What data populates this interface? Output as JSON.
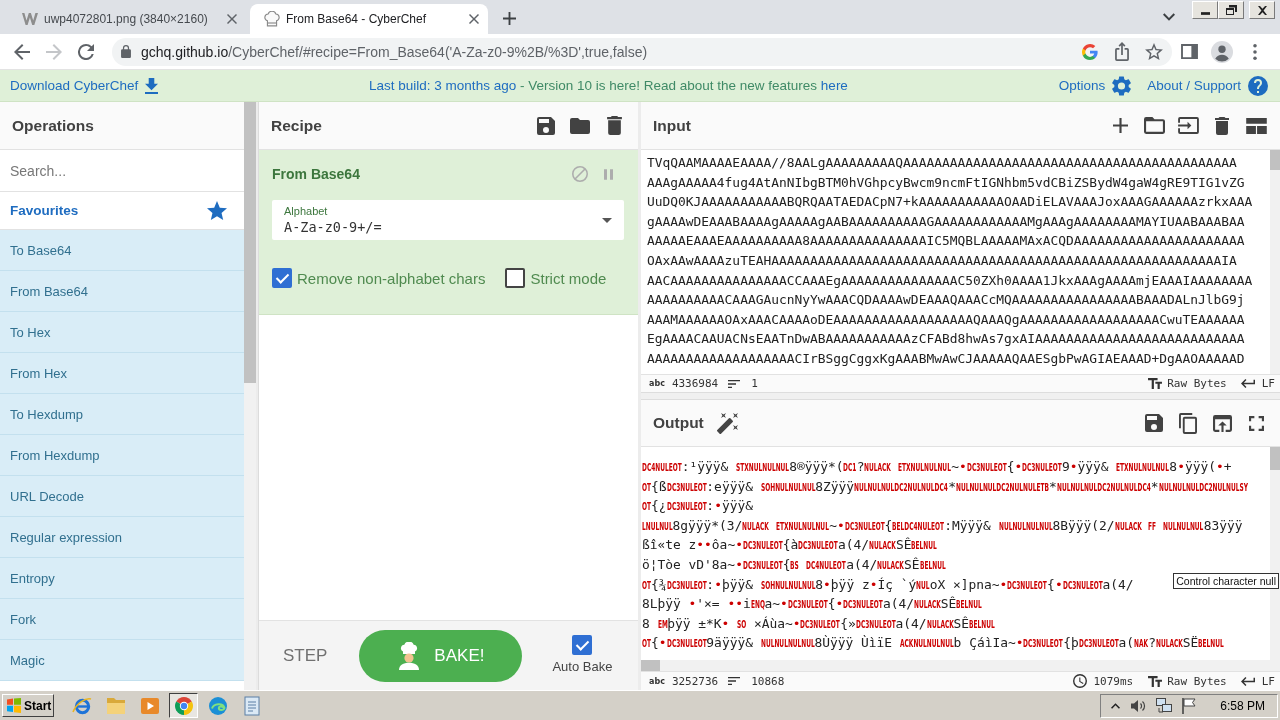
{
  "browser": {
    "tabs": [
      {
        "kind": "w-logo",
        "title": "uwp4072801.png (3840×2160)",
        "selected": false
      },
      {
        "kind": "chef-hat",
        "title": "From Base64 - CyberChef",
        "selected": true
      }
    ],
    "forward": {
      "disabled": true
    },
    "url": {
      "host": "gchq.github.io",
      "path": "/CyberChef/#recipe=From_Base64('A-Za-z0-9%2B/%3D',true,false)"
    }
  },
  "banner": {
    "download": "Download CyberChef",
    "notice": [
      {
        "kind": "link",
        "text": "Last build: 3 months ago"
      },
      {
        "kind": "text",
        "text": " - Version 10 is here! Read about the new features "
      },
      {
        "kind": "link",
        "text": "here"
      }
    ],
    "options": "Options",
    "about": "About / Support"
  },
  "operations": {
    "title": "Operations",
    "search": {
      "placeholder": "Search..."
    },
    "category": "Favourites",
    "items": [
      "To Base64",
      "From Base64",
      "To Hex",
      "From Hex",
      "To Hexdump",
      "From Hexdump",
      "URL Decode",
      "Regular expression",
      "Entropy",
      "Fork",
      "Magic"
    ]
  },
  "recipe": {
    "title": "Recipe",
    "operation": {
      "name": "From Base64",
      "field": {
        "label": "Alphabet",
        "value": "A-Za-z0-9+/="
      },
      "options": [
        {
          "label": "Remove non-alphabet chars",
          "checked": true
        },
        {
          "label": "Strict mode",
          "checked": false
        }
      ]
    },
    "step": "STEP",
    "bake": "BAKE!",
    "auto_bake": {
      "label": "Auto Bake",
      "checked": true
    }
  },
  "input": {
    "title": "Input",
    "lines": [
      "TVqQAAMAAAAEAAAA//8AALgAAAAAAAAAQAAAAAAAAAAAAAAAAAAAAAAAAAAAAAAAAAAAAAAAAAAA",
      "AAAgAAAAA4fug4AtAnNIbgBTM0hVGhpcyBwcm9ncmFtIGNhbm5vdCBiZSBydW4gaW4gRE9TIG1vZG",
      "UuDQ0KJAAAAAAAAAAABQRQAATAEDACpN7+kAAAAAAAAAAAOAADiELAVAAAJoxAAAGAAAAAAzrkxAAA",
      "gAAAAwDEAAABAAAAgAAAAAgAABAAAAAAAAAAGAAAAAAAAAAAAMgAAAgAAAAAAAAMAYIUAABAAABAA",
      "AAAAAEAAAEAAAAAAAAAA8AAAAAAAAAAAAAAAIC5MQBLAAAAAMAxACQDAAAAAAAAAAAAAAAAAAAAAA",
      "OAxAAwAAAAzuTEAHAAAAAAAAAAAAAAAAAAAAAAAAAAAAAAAAAAAAAAAAAAAAAAAAAAAAAAAAAAIA",
      "AACAAAAAAAAAAAAAAACCAAAEgAAAAAAAAAAAAAAAC50ZXh0AAAA1JkxAAAgAAAAmjEAAAIAAAAAAAA",
      "AAAAAAAAAACAAAGAucnNyYwAAACQDAAAAwDEAAAQAAACcMQAAAAAAAAAAAAAAAABAAADALnJlbG9j",
      "AAAMAAAAAAOAxAAACAAAAoDEAAAAAAAAAAAAAAAAAAQAAAQgAAAAAAAAAAAAAAAAAACwuTEAAAAAA",
      "EgAAAACAAUACNsEAATnDwABAAAAAAAAAAAzCFABd8hwAs7gxAIAAAAAAAAAAAAAAAAAAAAAAAAAAA",
      "AAAAAAAAAAAAAAAAAAACIrBSggCggxKgAAABMwAwCJAAAAAQAAESgbPwAGIAEAAAD+DgAAOAAAAAD"
    ],
    "status": {
      "length_label": "abc",
      "length": "4336984",
      "lines": "1",
      "encoding": "Raw Bytes",
      "eol": "LF"
    }
  },
  "output": {
    "title": "Output",
    "lines": [
      [
        {
          "kind": "ctrl",
          "text": "DC4NULEOT"
        },
        {
          "kind": "text",
          "text": ":¹ÿÿÿ& "
        },
        {
          "kind": "ctrl",
          "text": "STXNULNULNUL"
        },
        {
          "kind": "text",
          "text": "8®ÿÿÿ*("
        },
        {
          "kind": "ctrl",
          "text": "DC1"
        },
        {
          "kind": "text",
          "text": "?"
        },
        {
          "kind": "ctrl",
          "text": "NULACK "
        },
        {
          "kind": "ctrl",
          "text": "ETXNULNULNUL"
        },
        {
          "kind": "text",
          "text": "~"
        },
        {
          "kind": "dot",
          "text": "•"
        },
        {
          "kind": "ctrl",
          "text": "DC3NULEOT"
        },
        {
          "kind": "text",
          "text": "{"
        },
        {
          "kind": "dot",
          "text": "•"
        },
        {
          "kind": "ctrl",
          "text": "DC3NULEOT"
        },
        {
          "kind": "text",
          "text": "9"
        },
        {
          "kind": "dot",
          "text": "•"
        },
        {
          "kind": "text",
          "text": "ÿÿÿ& "
        },
        {
          "kind": "ctrl",
          "text": "ETXNULNULNUL"
        },
        {
          "kind": "text",
          "text": "8"
        },
        {
          "kind": "dot",
          "text": "•"
        },
        {
          "kind": "text",
          "text": "ÿÿÿ("
        },
        {
          "kind": "dot",
          "text": "•"
        },
        {
          "kind": "text",
          "text": "+"
        }
      ],
      [
        {
          "kind": "ctrl",
          "text": "OT"
        },
        {
          "kind": "text",
          "text": "{ß"
        },
        {
          "kind": "ctrl",
          "text": "DC3NULEOT"
        },
        {
          "kind": "text",
          "text": ":eÿÿÿ& "
        },
        {
          "kind": "ctrl",
          "text": "SOHNULNULNUL"
        },
        {
          "kind": "text",
          "text": "8Zÿÿÿ"
        },
        {
          "kind": "ctrl",
          "text": "NULNULNULDC2NULNULDC4"
        },
        {
          "kind": "text",
          "text": "*"
        },
        {
          "kind": "ctrl",
          "text": "NULNULNULDC2NULNULETB"
        },
        {
          "kind": "text",
          "text": "*"
        },
        {
          "kind": "ctrl",
          "text": "NULNULNULDC2NULNULDC4"
        },
        {
          "kind": "text",
          "text": "*"
        },
        {
          "kind": "ctrl",
          "text": "NULNULNULDC2NULNULSY"
        }
      ],
      [
        {
          "kind": "ctrl",
          "text": "OT"
        },
        {
          "kind": "text",
          "text": "{¿"
        },
        {
          "kind": "ctrl",
          "text": "DC3NULEOT"
        },
        {
          "kind": "text",
          "text": ":"
        },
        {
          "kind": "dot",
          "text": "•"
        },
        {
          "kind": "text",
          "text": "ÿÿÿ&"
        }
      ],
      [
        {
          "kind": "ctrl",
          "text": "LNULNUL"
        },
        {
          "kind": "text",
          "text": "8gÿÿÿ*(3/"
        },
        {
          "kind": "ctrl",
          "text": "NULACK "
        },
        {
          "kind": "ctrl",
          "text": "ETXNULNULNUL"
        },
        {
          "kind": "text",
          "text": "~"
        },
        {
          "kind": "dot",
          "text": "•"
        },
        {
          "kind": "ctrl",
          "text": "DC3NULEOT"
        },
        {
          "kind": "text",
          "text": "{"
        },
        {
          "kind": "ctrl",
          "text": "BELDC4NULEOT"
        },
        {
          "kind": "text",
          "text": ":Mÿÿÿ& "
        },
        {
          "kind": "ctrl",
          "text": "NULNULNULNUL"
        },
        {
          "kind": "text",
          "text": "8Bÿÿÿ(2/"
        },
        {
          "kind": "ctrl",
          "text": "NULACK "
        },
        {
          "kind": "ctrl",
          "text": "FF "
        },
        {
          "kind": "ctrl",
          "text": "NULNULNUL"
        },
        {
          "kind": "text",
          "text": "83ÿÿÿ"
        }
      ],
      [
        {
          "kind": "text",
          "text": "ßî«te z"
        },
        {
          "kind": "dot",
          "text": "••"
        },
        {
          "kind": "text",
          "text": "ôa~"
        },
        {
          "kind": "dot",
          "text": "•"
        },
        {
          "kind": "ctrl",
          "text": "DC3NULEOT"
        },
        {
          "kind": "text",
          "text": "{à"
        },
        {
          "kind": "ctrl",
          "text": "DC3NULEOT"
        },
        {
          "kind": "text",
          "text": "a(4/"
        },
        {
          "kind": "ctrl",
          "text": "NULACK"
        },
        {
          "kind": "text",
          "text": "SÊ"
        },
        {
          "kind": "ctrl",
          "text": "BELNUL"
        }
      ],
      [
        {
          "kind": "text",
          "text": "ö¦Tòe vD'8a~"
        },
        {
          "kind": "dot",
          "text": "•"
        },
        {
          "kind": "ctrl",
          "text": "DC3NULEOT"
        },
        {
          "kind": "text",
          "text": "{"
        },
        {
          "kind": "ctrl",
          "text": "BS "
        },
        {
          "kind": "ctrl",
          "text": "DC4NULEOT"
        },
        {
          "kind": "text",
          "text": "a(4/"
        },
        {
          "kind": "ctrl",
          "text": "NULACK"
        },
        {
          "kind": "text",
          "text": "SÊ"
        },
        {
          "kind": "ctrl",
          "text": "BELNUL"
        }
      ],
      [
        {
          "kind": "ctrl",
          "text": "OT"
        },
        {
          "kind": "text",
          "text": "{¾"
        },
        {
          "kind": "ctrl",
          "text": "DC3NULEOT"
        },
        {
          "kind": "text",
          "text": ":"
        },
        {
          "kind": "dot",
          "text": "•"
        },
        {
          "kind": "text",
          "text": "þÿÿ& "
        },
        {
          "kind": "ctrl",
          "text": "SOHNULNULNUL"
        },
        {
          "kind": "text",
          "text": "8"
        },
        {
          "kind": "dot",
          "text": "•"
        },
        {
          "kind": "text",
          "text": "þÿÿ z"
        },
        {
          "kind": "dot",
          "text": "•"
        },
        {
          "kind": "text",
          "text": "Íç `ý"
        },
        {
          "kind": "ctrl",
          "text": "NUL"
        },
        {
          "kind": "text",
          "text": "oX ×]pna~"
        },
        {
          "kind": "dot",
          "text": "•"
        },
        {
          "kind": "ctrl",
          "text": "DC3NULEOT"
        },
        {
          "kind": "text",
          "text": "{"
        },
        {
          "kind": "dot",
          "text": "•"
        },
        {
          "kind": "ctrl",
          "text": "DC3NULEOT"
        },
        {
          "kind": "text",
          "text": "a(4/"
        }
      ],
      [
        {
          "kind": "text",
          "text": "8Lþÿÿ "
        },
        {
          "kind": "dot",
          "text": "•"
        },
        {
          "kind": "text",
          "text": "'×= "
        },
        {
          "kind": "dot",
          "text": "••"
        },
        {
          "kind": "text",
          "text": "i"
        },
        {
          "kind": "ctrl",
          "text": "ENQ"
        },
        {
          "kind": "text",
          "text": "a~"
        },
        {
          "kind": "dot",
          "text": "•"
        },
        {
          "kind": "ctrl",
          "text": "DC3NULEOT"
        },
        {
          "kind": "text",
          "text": "{"
        },
        {
          "kind": "dot",
          "text": "•"
        },
        {
          "kind": "ctrl",
          "text": "DC3NULEOT"
        },
        {
          "kind": "text",
          "text": "a(4/"
        },
        {
          "kind": "ctrl",
          "text": "NULACK"
        },
        {
          "kind": "text",
          "text": "SÊ"
        },
        {
          "kind": "ctrl",
          "text": "BELNUL"
        }
      ],
      [
        {
          "kind": "text",
          "text": "8 "
        },
        {
          "kind": "ctrl",
          "text": "EM"
        },
        {
          "kind": "text",
          "text": "þÿÿ ±*K"
        },
        {
          "kind": "dot",
          "text": "• "
        },
        {
          "kind": "ctrl",
          "text": "SO"
        },
        {
          "kind": "text",
          "text": " ×Áùa~"
        },
        {
          "kind": "dot",
          "text": "•"
        },
        {
          "kind": "ctrl",
          "text": "DC3NULEOT"
        },
        {
          "kind": "text",
          "text": "{»"
        },
        {
          "kind": "ctrl",
          "text": "DC3NULEOT"
        },
        {
          "kind": "text",
          "text": "a(4/"
        },
        {
          "kind": "ctrl",
          "text": "NULACK"
        },
        {
          "kind": "text",
          "text": "SÊ"
        },
        {
          "kind": "ctrl",
          "text": "BELNUL"
        }
      ],
      [
        {
          "kind": "ctrl",
          "text": "OT"
        },
        {
          "kind": "text",
          "text": "{"
        },
        {
          "kind": "dot",
          "text": "•"
        },
        {
          "kind": "ctrl",
          "text": "DC3NULEOT"
        },
        {
          "kind": "text",
          "text": "9äÿÿÿ& "
        },
        {
          "kind": "ctrl",
          "text": "NULNULNULNUL"
        },
        {
          "kind": "text",
          "text": "8Ùÿÿÿ ÙìïE "
        },
        {
          "kind": "ctrl",
          "text": "ACKNULNULNUL"
        },
        {
          "kind": "text",
          "text": "b ÇáìIa~"
        },
        {
          "kind": "dot",
          "text": "•"
        },
        {
          "kind": "ctrl",
          "text": "DC3NULEOT"
        },
        {
          "kind": "text",
          "text": "{þ"
        },
        {
          "kind": "ctrl",
          "text": "DC3NULEOT"
        },
        {
          "kind": "text",
          "text": "a("
        },
        {
          "kind": "ctrl",
          "text": "NAK"
        },
        {
          "kind": "text",
          "text": "?"
        },
        {
          "kind": "ctrl",
          "text": "NULACK"
        },
        {
          "kind": "text",
          "text": "SË"
        },
        {
          "kind": "ctrl",
          "text": "BELNUL"
        }
      ]
    ],
    "tooltip": "Control character null",
    "status": {
      "length_label": "abc",
      "length": "3252736",
      "lines": "10868",
      "time": "1079ms",
      "encoding": "Raw Bytes",
      "eol": "LF"
    }
  },
  "taskbar": {
    "start": "Start",
    "apps": [
      {
        "kind": "e-globe",
        "selected": false
      },
      {
        "kind": "folder",
        "selected": false
      },
      {
        "kind": "media",
        "selected": false
      },
      {
        "kind": "ball",
        "selected": true
      },
      {
        "kind": "swirl",
        "selected": false
      },
      {
        "kind": "notepad",
        "selected": false
      }
    ],
    "clock": "6:58 PM"
  }
}
